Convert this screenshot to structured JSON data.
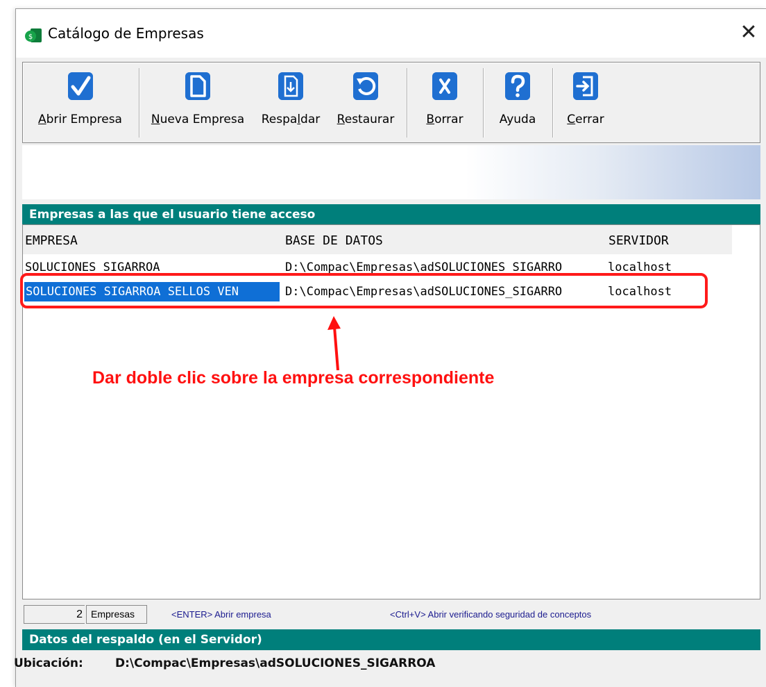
{
  "window": {
    "title": "Catálogo de Empresas",
    "close_glyph": "✕"
  },
  "toolbar": {
    "buttons": [
      {
        "label": "Abrir Empresa",
        "accel": "A",
        "icon": "checkmark-icon"
      },
      {
        "label": "Nueva Empresa",
        "accel": "N",
        "icon": "new-document-icon"
      },
      {
        "label": "Respaldar",
        "accel": "l",
        "icon": "backup-icon"
      },
      {
        "label": "Restaurar",
        "accel": "R",
        "icon": "restore-icon"
      },
      {
        "label": "Borrar",
        "accel": "B",
        "icon": "delete-x-icon"
      },
      {
        "label": "Ayuda",
        "accel": "",
        "icon": "help-icon"
      },
      {
        "label": "Cerrar",
        "accel": "C",
        "icon": "exit-icon"
      }
    ]
  },
  "companies_section": {
    "header": "Empresas a las que el usuario tiene acceso",
    "columns": [
      "EMPRESA",
      "BASE DE DATOS",
      "SERVIDOR"
    ],
    "rows": [
      {
        "empresa": "SOLUCIONES SIGARROA",
        "base": "D:\\Compac\\Empresas\\adSOLUCIONES_SIGARRO",
        "servidor": "localhost",
        "selected": false
      },
      {
        "empresa": "SOLUCIONES SIGARROA SELLOS VEN",
        "base": "D:\\Compac\\Empresas\\adSOLUCIONES_SIGARRO",
        "servidor": "localhost",
        "selected": true
      }
    ]
  },
  "annotation": {
    "text": "Dar doble clic sobre la empresa correspondiente",
    "color": "#ff1010"
  },
  "status": {
    "count": "2",
    "count_label": "Empresas",
    "hint_enter": "<ENTER> Abrir empresa",
    "hint_ctrlv": "<Ctrl+V>  Abrir verificando seguridad de conceptos"
  },
  "backup_section": {
    "header": "Datos del respaldo (en el Servidor)",
    "location_label": "Ubicación:",
    "location_value": "D:\\Compac\\Empresas\\adSOLUCIONES_SIGARROA"
  },
  "colors": {
    "teal": "#007f7b",
    "selection": "#0f6fd6",
    "icon_blue": "#1f6fd1"
  }
}
